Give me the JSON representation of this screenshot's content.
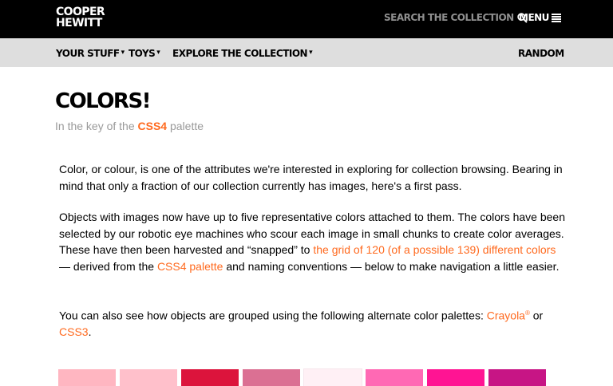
{
  "header": {
    "logo_line1": "COOPER",
    "logo_line2": "HEWITT",
    "search_label": "SEARCH THE COLLECTION",
    "menu_label": "MENU"
  },
  "nav": {
    "items": [
      {
        "label": "YOUR STUFF"
      },
      {
        "label": "TOYS"
      },
      {
        "label": "EXPLORE THE COLLECTION"
      }
    ],
    "caret": "▾",
    "random": "RANDOM"
  },
  "page": {
    "title": "COLORS!",
    "subtitle_prefix": "In the key of the ",
    "subtitle_link": "CSS4",
    "subtitle_suffix": " palette"
  },
  "body": {
    "p1": "Color, or colour, is one of the attributes we're interested in exploring for collection browsing. Bearing in mind that only a fraction of our collection currently has images, here's a first pass.",
    "p2_a": "Objects with images now have up to five representative colors attached to them. The colors have been selected by our robotic eye machines who scour each image in small chunks to create color averages. These have then been harvested and “snapped” to ",
    "p2_link1": "the grid of 120 (of a possible 139) different colors",
    "p2_b": " — derived from the ",
    "p2_link2": "CSS4 palette",
    "p2_c": " and naming conventions — below to make navigation a little easier.",
    "p3_a": "You can also see how objects are grouped using the following alternate color palettes: ",
    "p3_link1": "Crayola",
    "p3_reg": "®",
    "p3_b": " or ",
    "p3_link2": "CSS3",
    "p3_c": "."
  },
  "colors": {
    "accent": "#ff6a1f",
    "swatches": [
      "#ffb6c1",
      "#ffc0cb",
      "#dc143c",
      "#db7093",
      "#fff0f5",
      "#ff69b4",
      "#ff1493",
      "#c71585"
    ]
  }
}
